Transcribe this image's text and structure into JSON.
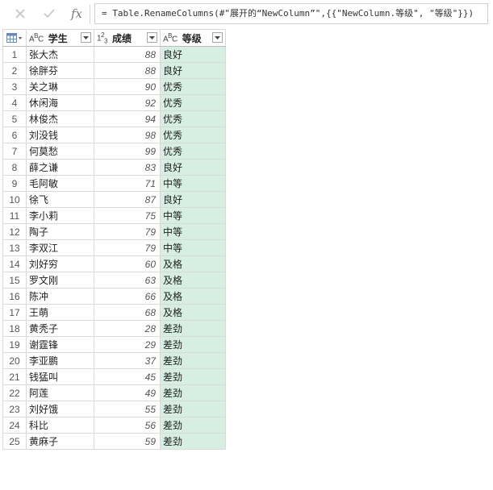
{
  "formula_bar": {
    "cancel_icon": "x-icon",
    "commit_icon": "check-icon",
    "fx_label": "fx",
    "formula": "= Table.RenameColumns(#\"展开的“NewColumn”\",{{\"NewColumn.等级\", \"等级\"}})"
  },
  "columns": [
    {
      "type_label": "ABC",
      "label": "学生"
    },
    {
      "type_label": "123",
      "label": "成绩"
    },
    {
      "type_label": "ABC",
      "label": "等级"
    }
  ],
  "rows": [
    {
      "idx": "1",
      "name": "张大杰",
      "score": "88",
      "grade": "良好"
    },
    {
      "idx": "2",
      "name": "徐胖芬",
      "score": "88",
      "grade": "良好"
    },
    {
      "idx": "3",
      "name": "关之琳",
      "score": "90",
      "grade": "优秀"
    },
    {
      "idx": "4",
      "name": "休闲海",
      "score": "92",
      "grade": "优秀"
    },
    {
      "idx": "5",
      "name": "林俊杰",
      "score": "94",
      "grade": "优秀"
    },
    {
      "idx": "6",
      "name": "刘没钱",
      "score": "98",
      "grade": "优秀"
    },
    {
      "idx": "7",
      "name": "何莫愁",
      "score": "99",
      "grade": "优秀"
    },
    {
      "idx": "8",
      "name": "薛之谦",
      "score": "83",
      "grade": "良好"
    },
    {
      "idx": "9",
      "name": "毛阿敏",
      "score": "71",
      "grade": "中等"
    },
    {
      "idx": "10",
      "name": "徐飞",
      "score": "87",
      "grade": "良好"
    },
    {
      "idx": "11",
      "name": "李小莉",
      "score": "75",
      "grade": "中等"
    },
    {
      "idx": "12",
      "name": "陶子",
      "score": "79",
      "grade": "中等"
    },
    {
      "idx": "13",
      "name": "李双江",
      "score": "79",
      "grade": "中等"
    },
    {
      "idx": "14",
      "name": "刘好穷",
      "score": "60",
      "grade": "及格"
    },
    {
      "idx": "15",
      "name": "罗文刚",
      "score": "63",
      "grade": "及格"
    },
    {
      "idx": "16",
      "name": "陈冲",
      "score": "66",
      "grade": "及格"
    },
    {
      "idx": "17",
      "name": "王萌",
      "score": "68",
      "grade": "及格"
    },
    {
      "idx": "18",
      "name": "黄秃子",
      "score": "28",
      "grade": "差劲"
    },
    {
      "idx": "19",
      "name": "谢霆锋",
      "score": "29",
      "grade": "差劲"
    },
    {
      "idx": "20",
      "name": "李亚鹏",
      "score": "37",
      "grade": "差劲"
    },
    {
      "idx": "21",
      "name": "钱猛叫",
      "score": "45",
      "grade": "差劲"
    },
    {
      "idx": "22",
      "name": "阿莲",
      "score": "49",
      "grade": "差劲"
    },
    {
      "idx": "23",
      "name": "刘好饿",
      "score": "55",
      "grade": "差劲"
    },
    {
      "idx": "24",
      "name": "科比",
      "score": "56",
      "grade": "差劲"
    },
    {
      "idx": "25",
      "name": "黄麻子",
      "score": "59",
      "grade": "差劲"
    }
  ]
}
